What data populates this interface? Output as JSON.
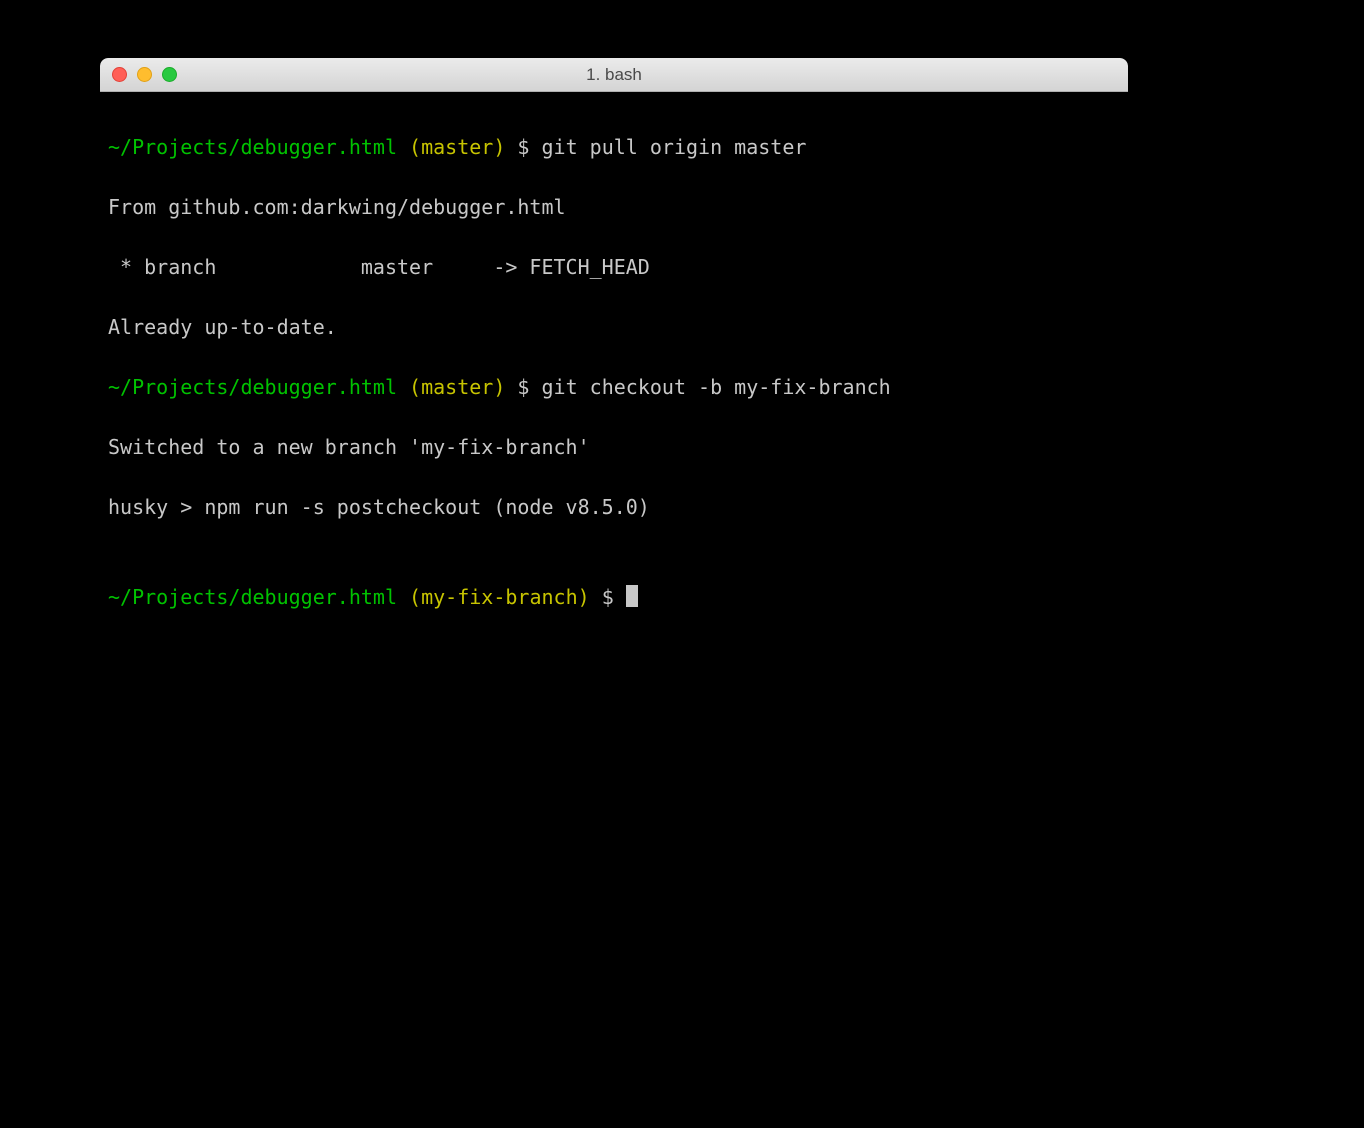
{
  "window": {
    "title": "1. bash"
  },
  "prompt1": {
    "path": "~/Projects/debugger.html",
    "branch_open": " (",
    "branch": "master",
    "branch_close": ")",
    "dollar": " $ ",
    "command": "git pull origin master"
  },
  "output1": {
    "line1": "From github.com:darkwing/debugger.html",
    "line2": " * branch            master     -> FETCH_HEAD",
    "line3": "Already up-to-date."
  },
  "prompt2": {
    "path": "~/Projects/debugger.html",
    "branch_open": " (",
    "branch": "master",
    "branch_close": ")",
    "dollar": " $ ",
    "command": "git checkout -b my-fix-branch"
  },
  "output2": {
    "line1": "Switched to a new branch 'my-fix-branch'",
    "line2": "husky > npm run -s postcheckout (node v8.5.0)",
    "blank": ""
  },
  "prompt3": {
    "path": "~/Projects/debugger.html",
    "branch_open": " (",
    "branch": "my-fix-branch",
    "branch_close": ")",
    "dollar": " $ "
  }
}
